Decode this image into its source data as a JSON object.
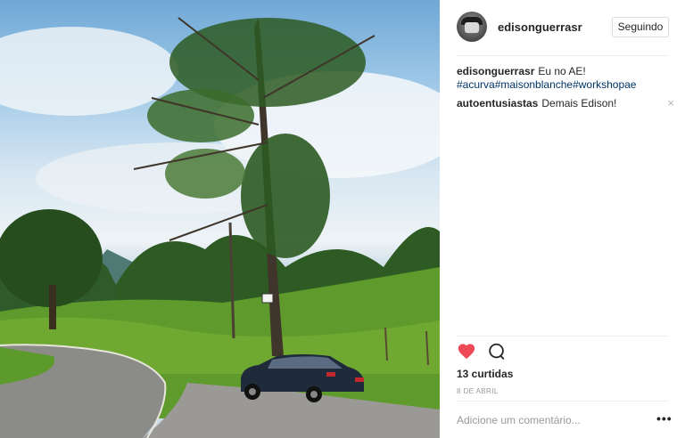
{
  "post": {
    "username": "edisonguerrasr",
    "follow_label": "Seguindo",
    "comments": [
      {
        "author": "edisonguerrasr",
        "text": "Eu no AE!",
        "hashtags": "#acurva#maisonblanche#workshopae"
      },
      {
        "author": "autoentusiastas",
        "text": "Demais Edison!",
        "remove": "×"
      }
    ],
    "likes_text": "13 curtidas",
    "date_text": "8 DE ABRIL",
    "comment_placeholder": "Adicione um comentário...",
    "more_label": "•••"
  },
  "icons": {
    "like": "heart-icon",
    "comment": "speech-bubble-icon",
    "like_color": "#ed4956"
  }
}
